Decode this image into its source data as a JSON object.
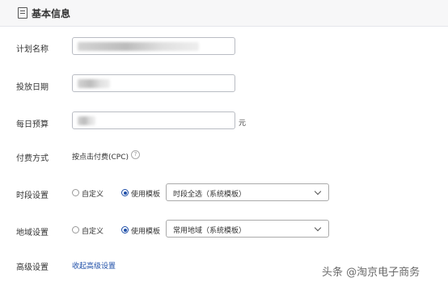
{
  "header": {
    "title": "基本信息",
    "icon": "document-icon"
  },
  "form": {
    "plan_name_label": "计划名称",
    "date_label": "投放日期",
    "budget_label": "每日预算",
    "budget_unit": "元",
    "payment_label": "付费方式",
    "payment_value": "按点击付费(CPC)",
    "time_label": "时段设置",
    "time_custom": "自定义",
    "time_template": "使用模板",
    "time_select_value": "时段全选（系统模板）",
    "region_label": "地域设置",
    "region_custom": "自定义",
    "region_template": "使用模板",
    "region_select_value": "常用地域（系统模板）",
    "advanced_label": "高级设置",
    "advanced_link": "收起高级设置"
  },
  "watermark": "头条 @淘京电子商务",
  "colors": {
    "accent": "#1f4fa8",
    "border": "#b9bcc3",
    "header_bg": "#f7f7f8"
  }
}
